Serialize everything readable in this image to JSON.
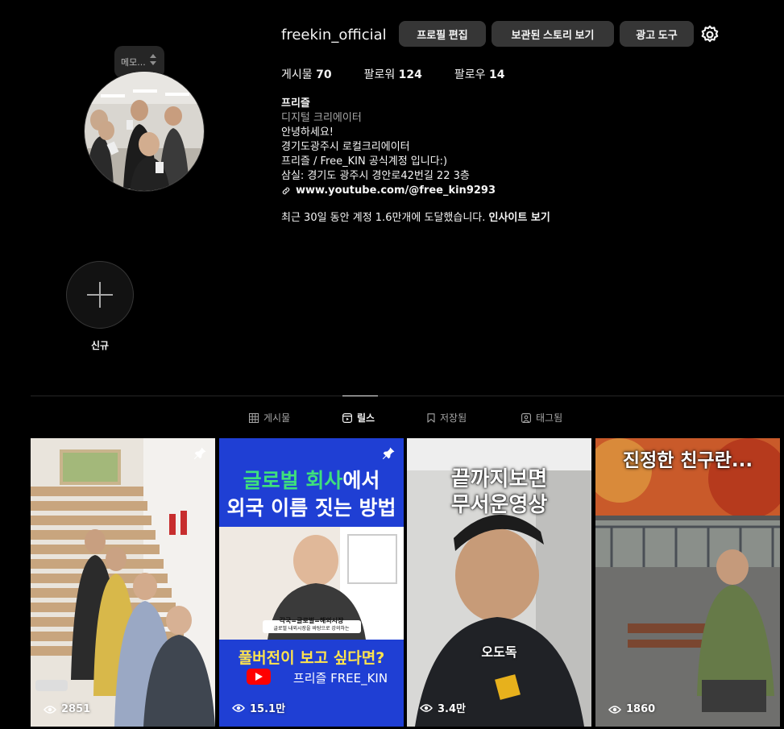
{
  "profile": {
    "username": "freekin_official",
    "note_text": "메모...",
    "buttons": {
      "edit": "프로필 편집",
      "archive": "보관된 스토리 보기",
      "ads": "광고 도구"
    }
  },
  "stats": {
    "posts_label": "게시물",
    "posts": "70",
    "followers_label": "팔로워",
    "followers": "124",
    "following_label": "팔로우",
    "following": "14"
  },
  "bio": {
    "name": "프리즐",
    "category": "디지털 크리에이터",
    "lines": [
      "안녕하세요!",
      "경기도광주시 로컬크리에이터",
      "프리즐 / Free_KIN 공식계정 입니다:)",
      "삼실: 경기도 광주시 경안로42번길 22 3층"
    ],
    "link": "www.youtube.com/@free_kin9293",
    "insight_text": "최근 30일 동안 계정 1.6만개에 도달했습니다.",
    "insight_link": "인사이트 보기"
  },
  "highlight": {
    "new_label": "신규"
  },
  "tabs": [
    {
      "label": "게시물",
      "icon": "grid-icon"
    },
    {
      "label": "릴스",
      "icon": "reels-icon"
    },
    {
      "label": "저장됨",
      "icon": "bookmark-icon"
    },
    {
      "label": "태그됨",
      "icon": "tag-icon"
    }
  ],
  "reels": [
    {
      "views": "2851",
      "pinned": true
    },
    {
      "views": "15.1만",
      "pinned": true,
      "title1": "글로벌 회사",
      "title2": "에서",
      "title3": "외국 이름 짓는 방법",
      "caption1": "각국=글로벌=해외시장",
      "caption2": "글로벌 내외시장을 바탕으로 강의하는",
      "bottom": "풀버전이 보고 싶다면?",
      "channel": "프리즐 FREE_KIN"
    },
    {
      "views": "3.4만",
      "pinned": false,
      "title1": "끝까지보면",
      "title2": "무서운영상",
      "caption": "오도독"
    },
    {
      "views": "1860",
      "pinned": false,
      "title": "진정한 친구란..."
    }
  ]
}
